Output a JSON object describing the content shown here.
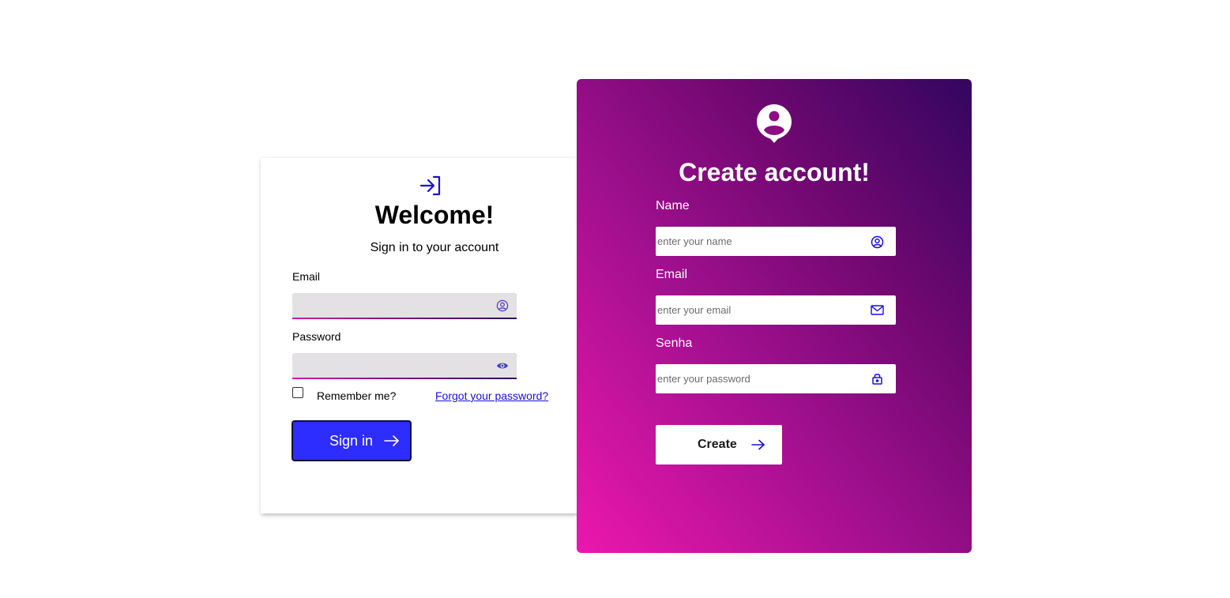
{
  "signin": {
    "title": "Welcome!",
    "subtitle": "Sign in to your account",
    "email_label": "Email",
    "email_value": "",
    "password_label": "Password",
    "password_value": "",
    "remember_label": "Remember me?",
    "remember_checked": false,
    "forgot_link": "Forgot your password?",
    "button_label": "Sign in",
    "icons": {
      "header": "sign-in-arrow-icon",
      "email": "user-circle-icon",
      "password": "eye-icon",
      "button": "arrow-right-icon"
    }
  },
  "create": {
    "title": "Create account!",
    "name_label": "Name",
    "name_placeholder": "enter your name",
    "email_label": "Email",
    "email_placeholder": "enter your email",
    "password_label": "Senha",
    "password_placeholder": "enter your password",
    "button_label": "Create",
    "icons": {
      "header": "user-location-icon",
      "name": "user-circle-icon",
      "email": "envelope-icon",
      "password": "lock-icon",
      "button": "arrow-right-icon"
    }
  },
  "colors": {
    "accent_blue": "#2d2dff",
    "icon_blue": "#1a0dd9",
    "gradient_start": "#ec17ae",
    "gradient_end": "#330660",
    "input_bg": "#e3e1e3"
  }
}
